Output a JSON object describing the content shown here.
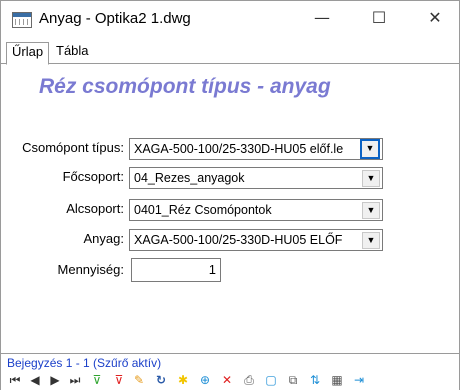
{
  "window": {
    "title": "Anyag - Optika2 1.dwg"
  },
  "controls": {
    "minimize": "—",
    "maximize": "☐",
    "close": "✕"
  },
  "tabs": [
    {
      "label": "Űrlap"
    },
    {
      "label": "Tábla"
    }
  ],
  "form": {
    "title": "Réz csomópont típus - anyag",
    "fields": {
      "csomopont_tipus": {
        "label": "Csomópont típus:",
        "value": "XAGA-500-100/25-330D-HU05 előf.le"
      },
      "focsoport": {
        "label": "Főcsoport:",
        "value": "04_Rezes_anyagok"
      },
      "alcsoport": {
        "label": "Alcsoport:",
        "value": "0401_Réz Csomópontok"
      },
      "anyag": {
        "label": "Anyag:",
        "value": "XAGA-500-100/25-330D-HU05 ELŐF"
      },
      "mennyiseg": {
        "label": "Mennyiség:",
        "value": "1"
      }
    },
    "dropdown_glyph": "▼"
  },
  "status": {
    "text": "Bejegyzés 1 - 1 (Szűrő aktív)"
  },
  "toolbar": {
    "first": "⏮",
    "prev": "◀",
    "next": "▶",
    "last": "⏭",
    "filter_add": "⊽",
    "filter_remove": "⊽",
    "edit": "✎",
    "refresh": "↻",
    "new": "✱",
    "zoom": "⊕",
    "delete": "✕",
    "print": "⎙",
    "select": "▢",
    "copy": "⧉",
    "sort": "⇅",
    "table": "▦",
    "exit": "⇥"
  },
  "colors": {
    "title": "#7a7ad2",
    "status": "#1a3fc9",
    "focus": "#0b62c4",
    "delete": "#e02020",
    "new": "#f2c500",
    "filter": "#2fa52f"
  }
}
